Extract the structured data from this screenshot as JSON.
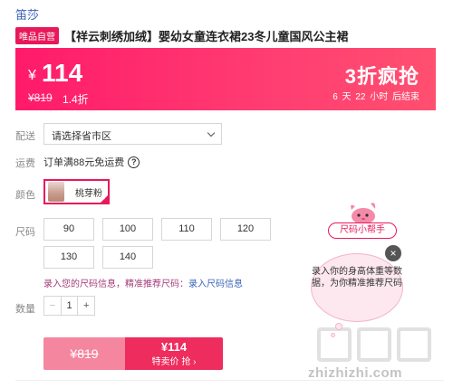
{
  "brand": "笛莎",
  "product": {
    "badge": "唯品自营",
    "title": "【祥云刺绣加绒】婴幼女童连衣裙23冬儿童国风公主裙"
  },
  "price": {
    "currency": "¥",
    "current": "114",
    "original": "¥819",
    "discount": "1.4折",
    "promo_label": "3折疯抢",
    "countdown": "6 天 22 小时 后结束"
  },
  "delivery": {
    "label": "配送",
    "placeholder": "请选择省市区"
  },
  "freight": {
    "label": "运费",
    "text": "订单满88元免运费",
    "help_icon": "question-circle-icon"
  },
  "color": {
    "label": "颜色",
    "selected": "桃芽粉"
  },
  "size": {
    "label": "尺码",
    "options": [
      "90",
      "100",
      "110",
      "120",
      "130",
      "140"
    ],
    "hint_text": "录入您的尺码信息，精准推荐尺码：",
    "hint_link": "录入尺码信息"
  },
  "quantity": {
    "label": "数量",
    "value": "1",
    "minus": "−",
    "plus": "+"
  },
  "buy": {
    "original": "¥819",
    "price": "¥114",
    "action": "特卖价 抢 ›"
  },
  "helper": {
    "tag": "尺码小帮手",
    "bubble_text": "录入你的身高体重等数据，为你精准推荐尺码",
    "close": "×"
  },
  "watermark": "zhizhizhi.com",
  "colors": {
    "accent": "#e8195a",
    "banner_start": "#ff1a6a",
    "banner_end": "#ff4f6f",
    "link": "#3c63b8"
  }
}
